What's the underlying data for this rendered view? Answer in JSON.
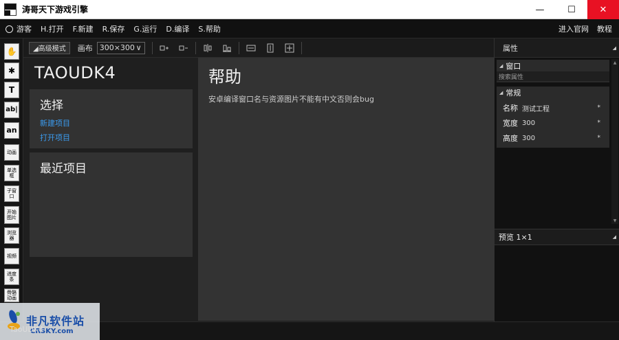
{
  "window": {
    "title": "涛哥天下游戏引擎",
    "icon_name": "tao-app-icon",
    "minimize_glyph": "—",
    "maximize_glyph": "☐",
    "close_glyph": "✕"
  },
  "menu": {
    "guest": "游客",
    "items": [
      "H.打开",
      "F.新建",
      "R.保存",
      "G.运行",
      "D.编译",
      "S.帮助"
    ],
    "right": [
      "进入官网",
      "教程"
    ]
  },
  "tools": [
    "✋",
    "✱",
    "T",
    "ab|",
    "an",
    "动画",
    "单选框",
    "子窗口",
    "开始图片",
    "浏览器",
    "视频",
    "进度条",
    "骨骼动画"
  ],
  "toolbar": {
    "advanced_mode": "◢高级模式",
    "canvas_label": "画布",
    "canvas_size": "300×300",
    "canvas_arrow": "∨"
  },
  "project": {
    "title": "TAOUDK4",
    "select": {
      "heading": "选择",
      "links": [
        "新建项目",
        "打开项目"
      ]
    },
    "recent": {
      "heading": "最近项目"
    }
  },
  "help": {
    "title": "帮助",
    "text": "安卓编译窗口名与资源图片不能有中文否则会bug"
  },
  "properties": {
    "header": "属性",
    "window_section": "窗口",
    "search_placeholder": "搜索属性",
    "general_section": "常规",
    "rows": [
      {
        "key": "名称",
        "value": "测试工程",
        "mark": "*"
      },
      {
        "key": "宽度",
        "value": "300",
        "mark": "*"
      },
      {
        "key": "高度",
        "value": "300",
        "mark": "*"
      }
    ],
    "preview": "预览 1×1"
  },
  "watermark": {
    "cn": "非凡软件站",
    "en": "CRSKY.com",
    "overlay": "TaoUDK4"
  },
  "colors": {
    "link": "#3b9cf0",
    "close": "#e81123",
    "watermark": "#1a4ea8"
  }
}
